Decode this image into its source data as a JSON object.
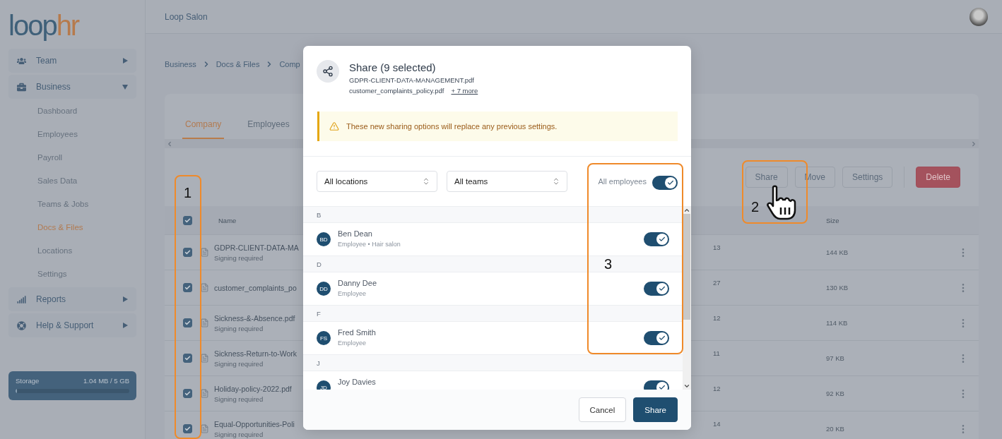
{
  "sidebar": {
    "logo": {
      "part_1": "loop",
      "part_2": "hr"
    },
    "nav": [
      {
        "label": "Team",
        "expanded": false
      },
      {
        "label": "Business",
        "expanded": true,
        "children": [
          {
            "label": "Dashboard",
            "selected": false
          },
          {
            "label": "Employees",
            "selected": false
          },
          {
            "label": "Payroll",
            "selected": false
          },
          {
            "label": "Sales Data",
            "selected": false
          },
          {
            "label": "Teams & Jobs",
            "selected": false
          },
          {
            "label": "Docs & Files",
            "selected": true
          },
          {
            "label": "Locations",
            "selected": false
          },
          {
            "label": "Settings",
            "selected": false
          }
        ]
      },
      {
        "label": "Reports",
        "expanded": false
      },
      {
        "label": "Help & Support",
        "expanded": false
      }
    ],
    "storage": {
      "label": "Storage",
      "reading": "1.04 MB / 5 GB",
      "level": 0.01
    }
  },
  "header": {
    "title": "Loop Salon"
  },
  "breadcrumb": [
    "Business",
    "Docs & Files",
    "Comp"
  ],
  "tabs": [
    {
      "label": "Company",
      "selected": true
    },
    {
      "label": "Employees",
      "selected": false
    }
  ],
  "toolbar": [
    {
      "label": "Share",
      "kind": "default"
    },
    {
      "label": "Move",
      "kind": "default"
    },
    {
      "label": "Settings",
      "kind": "default"
    },
    {
      "label": "Delete",
      "kind": "danger"
    }
  ],
  "table": {
    "columns": [
      "Name",
      "Size"
    ],
    "all_checked": true,
    "rows": [
      {
        "checked": true,
        "name": "GDPR-CLIENT-DATA-MA",
        "note": "Signing required",
        "column_3": "13",
        "size": "144 KB"
      },
      {
        "checked": true,
        "name": "customer_complaints_po",
        "column_3": "27",
        "size": "130 KB"
      },
      {
        "checked": true,
        "name": "Sickness-&-Absence.pdf",
        "note": "Signing required",
        "column_3": "12",
        "size": "114 KB"
      },
      {
        "checked": true,
        "name": "Sickness-Return-to-Work",
        "note": "Signing required",
        "column_3": "11",
        "size": "97 KB"
      },
      {
        "checked": true,
        "name": "Holiday-policy-2022.pdf",
        "note": "Signing required",
        "column_3": "12",
        "size": "92 KB"
      },
      {
        "checked": true,
        "name": "Equal-Opportunities-Poli",
        "note": "Signing required",
        "column_3": "14",
        "size": "20 KB"
      }
    ]
  },
  "dialog": {
    "title": "Share (9 selected)",
    "files": [
      "GDPR-CLIENT-DATA-MANAGEMENT.pdf",
      "customer_complaints_policy.pdf"
    ],
    "more_link": "+ 7 more",
    "warning": "These new sharing options will replace any previous settings.",
    "filters": [
      {
        "value": "All locations"
      },
      {
        "value": "All teams"
      }
    ],
    "all_employees": {
      "label": "All employees",
      "on": true
    },
    "groups": [
      {
        "letter": "B",
        "people": [
          {
            "initials": "BD",
            "name": "Ben Dean",
            "role": "Employee • Hair salon",
            "on": true
          }
        ]
      },
      {
        "letter": "D",
        "people": [
          {
            "initials": "DD",
            "name": "Danny Dee",
            "role": "Employee",
            "on": true
          }
        ]
      },
      {
        "letter": "F",
        "people": [
          {
            "initials": "FS",
            "name": "Fred Smith",
            "role": "Employee",
            "on": true
          }
        ]
      },
      {
        "letter": "J",
        "people": [
          {
            "initials": "JD",
            "name": "Joy Davies",
            "on": true
          }
        ]
      }
    ],
    "buttons": [
      {
        "label": "Cancel",
        "kind": "secondary"
      },
      {
        "label": "Share",
        "kind": "primary"
      }
    ]
  },
  "annotations": [
    {
      "label": "1"
    },
    {
      "label": "2"
    },
    {
      "label": "3"
    }
  ]
}
